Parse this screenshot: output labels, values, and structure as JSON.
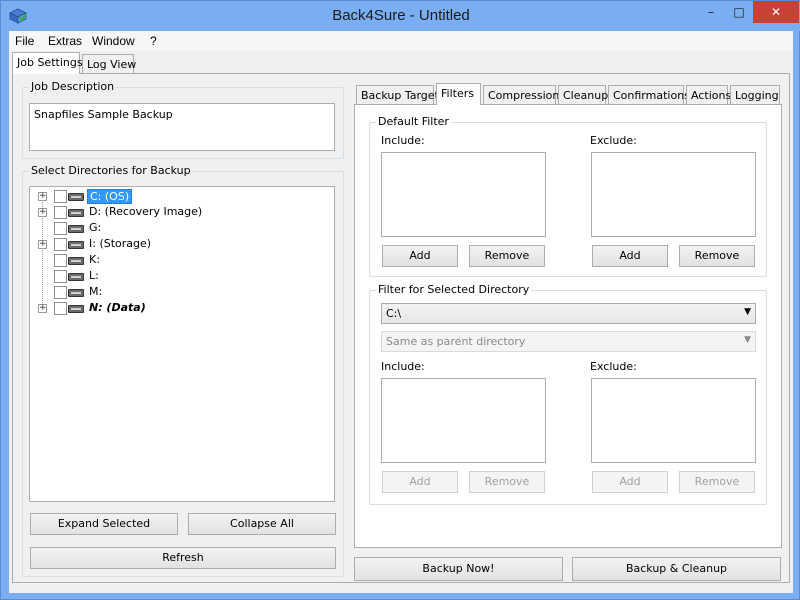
{
  "window": {
    "title": "Back4Sure - Untitled",
    "controls": {
      "minimize": "–",
      "maximize": "□",
      "close": "✕"
    }
  },
  "menu": [
    "File",
    "Extras",
    "Window",
    "?"
  ],
  "main_tabs": [
    "Job Settings",
    "Log View"
  ],
  "job_description": {
    "label": "Job Description",
    "value": "Snapfiles Sample Backup"
  },
  "directories": {
    "label": "Select Directories for Backup",
    "items": [
      {
        "label": "C: (OS)",
        "expandable": true,
        "selected": true
      },
      {
        "label": "D: (Recovery Image)",
        "expandable": true
      },
      {
        "label": "G:",
        "expandable": false
      },
      {
        "label": "I: (Storage)",
        "expandable": true
      },
      {
        "label": "K:",
        "expandable": false
      },
      {
        "label": "L:",
        "expandable": false
      },
      {
        "label": "M:",
        "expandable": false
      },
      {
        "label": "N: (Data)",
        "expandable": true,
        "italic": true
      }
    ],
    "buttons": {
      "expand": "Expand Selected",
      "collapse": "Collapse All",
      "refresh": "Refresh"
    }
  },
  "settings_tabs": [
    "Backup Target",
    "Filters",
    "Compression",
    "Cleanup",
    "Confirmations",
    "Actions",
    "Logging"
  ],
  "default_filter": {
    "label": "Default Filter",
    "include_label": "Include:",
    "exclude_label": "Exclude:",
    "add": "Add",
    "remove": "Remove"
  },
  "dir_filter": {
    "label": "Filter for Selected Directory",
    "directory": "C:\\",
    "mode": "Same as parent directory",
    "include_label": "Include:",
    "exclude_label": "Exclude:",
    "add": "Add",
    "remove": "Remove"
  },
  "actions": {
    "backup_now": "Backup Now!",
    "backup_cleanup": "Backup & Cleanup"
  }
}
